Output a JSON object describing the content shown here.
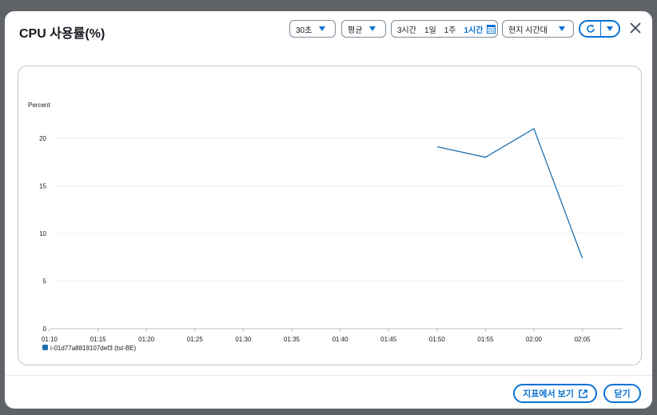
{
  "modal": {
    "title": "CPU 사용률(%)"
  },
  "controls": {
    "period": {
      "value": "30초",
      "icon": "caret-down-icon"
    },
    "statistic": {
      "value": "평균",
      "icon": "caret-down-icon"
    },
    "time_range": {
      "options": [
        "3시간",
        "1일",
        "1주",
        "1시간"
      ],
      "selected": "1시간",
      "icon": "calendar-icon"
    },
    "timezone": {
      "value": "현지 시간대",
      "icon": "caret-down-icon"
    },
    "refresh": {
      "icon": "refresh-icon",
      "menu_icon": "caret-down-icon"
    },
    "close": {
      "icon": "close-icon"
    }
  },
  "chart_data": {
    "type": "line",
    "ylabel": "Percent",
    "ylim": [
      0,
      22
    ],
    "yticks": [
      0,
      5,
      10,
      15,
      20
    ],
    "x": [
      "01:10",
      "01:15",
      "01:20",
      "01:25",
      "01:30",
      "01:35",
      "01:40",
      "01:45",
      "01:50",
      "01:55",
      "02:00",
      "02:05"
    ],
    "series": [
      {
        "name": "i-01d77a8819107def3 (tst-BE)",
        "color": "#1f6fae",
        "points": [
          {
            "x": "01:50",
            "y": 19.1
          },
          {
            "x": "01:55",
            "y": 18.0
          },
          {
            "x": "02:00",
            "y": 21.0
          },
          {
            "x": "02:05",
            "y": 7.4
          }
        ]
      }
    ],
    "grid": true,
    "legend": "bottom-left"
  },
  "footer": {
    "view_in_metrics": "지표에서 보기",
    "view_in_metrics_icon": "external-link-icon",
    "close": "닫기"
  },
  "colors": {
    "accent": "#0972d3",
    "series": "#1f6fae"
  }
}
